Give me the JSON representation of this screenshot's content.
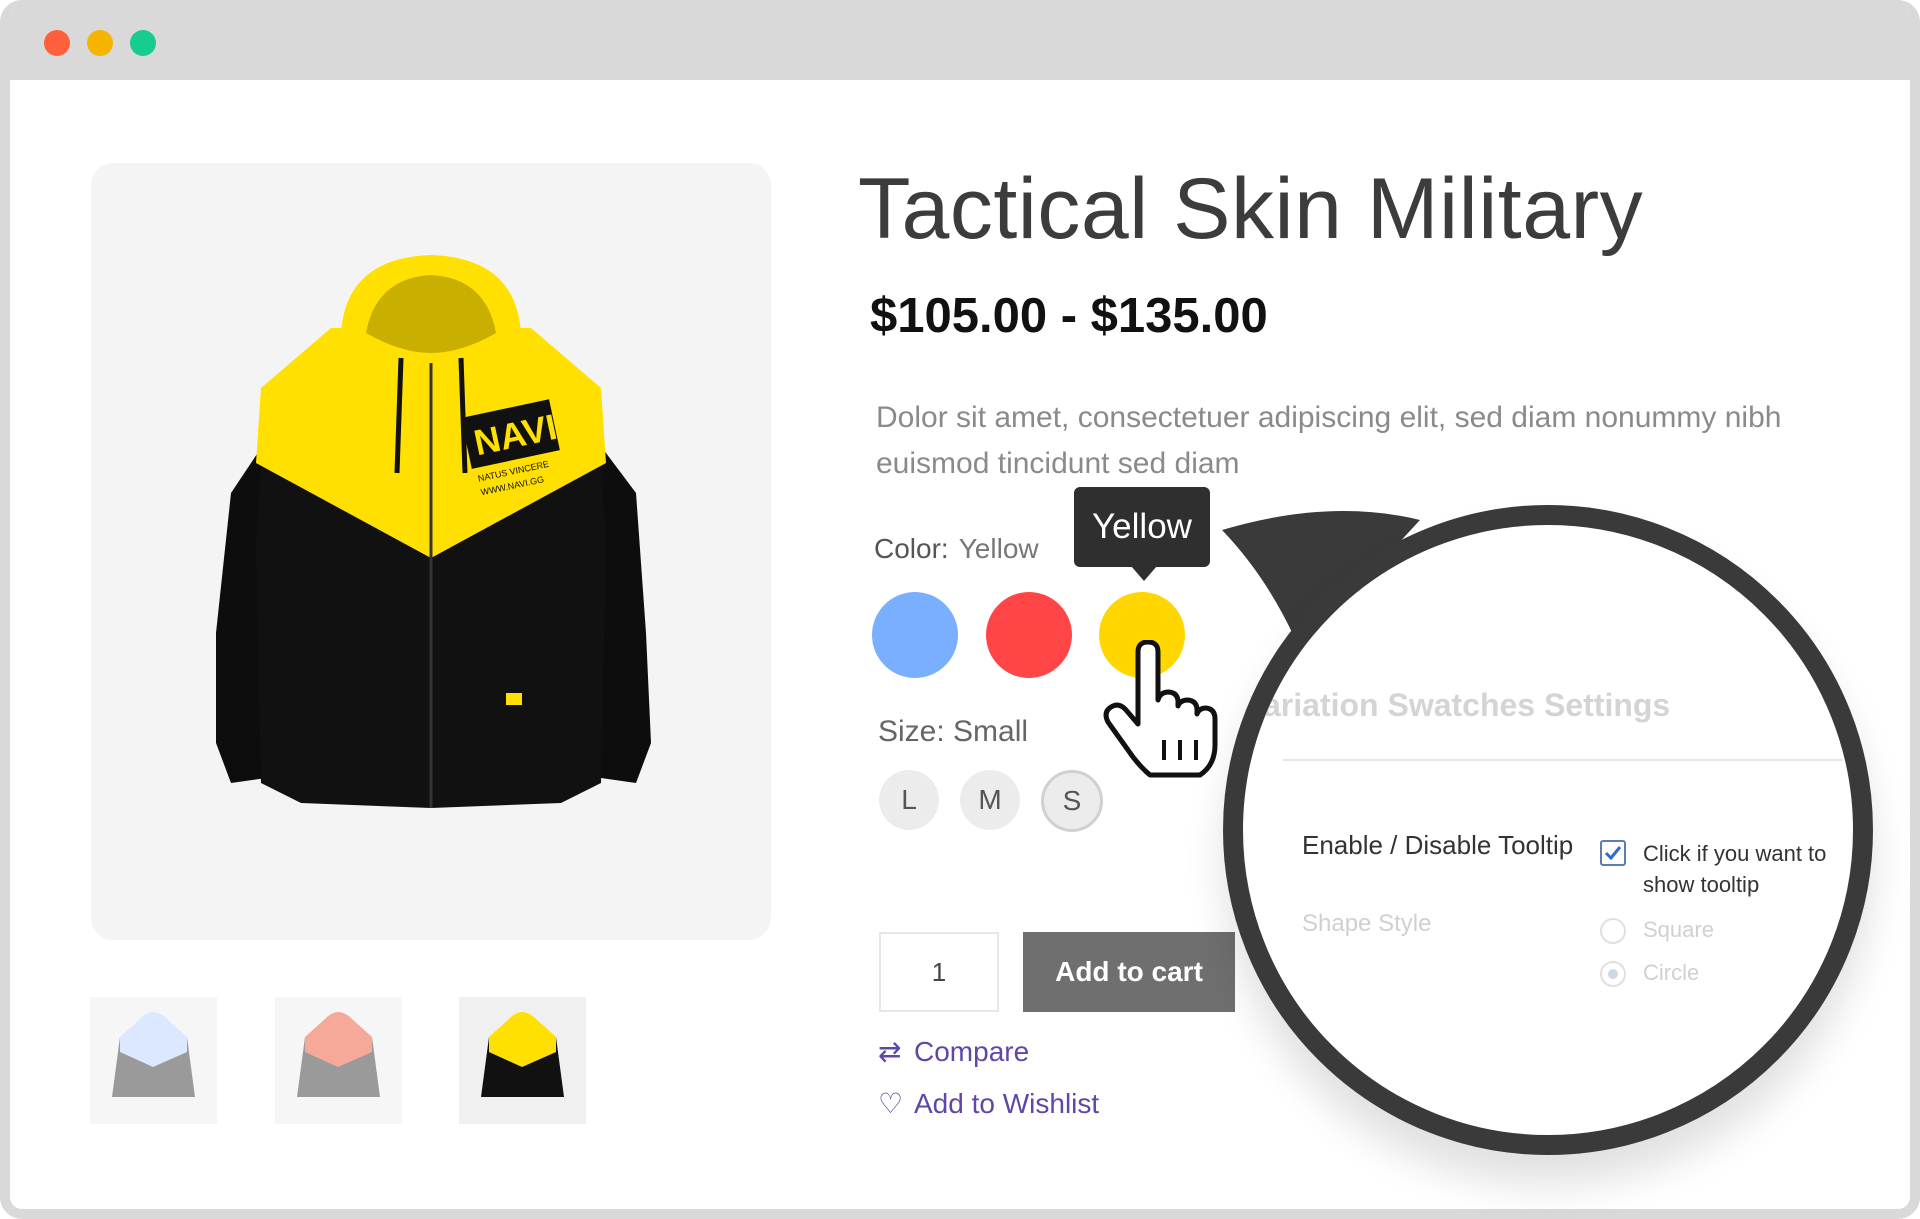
{
  "window": {
    "controls": [
      "close",
      "minimize",
      "maximize"
    ]
  },
  "product": {
    "title": "Tactical Skin Military",
    "price": "$105.00 - $135.00",
    "description": "Dolor sit amet, consectetuer adipiscing elit, sed diam nonummy nibh euismod tincidunt sed diam",
    "color_label": "Color:",
    "color_value": "Yellow",
    "colors": [
      {
        "name": "blue",
        "hex": "#7aaeff"
      },
      {
        "name": "red",
        "hex": "#ff4545"
      },
      {
        "name": "yellow",
        "hex": "#ffd600"
      }
    ],
    "tooltip": "Yellow",
    "size_label": "Size: Small",
    "sizes": [
      "L",
      "M",
      "S"
    ],
    "quantity": "1",
    "add_to_cart": "Add to cart",
    "compare": "Compare",
    "wishlist": "Add to Wishlist",
    "logo_text": "NAVI",
    "logo_sub": "NATUS VINCERE",
    "logo_url": "WWW.NAVI.GG"
  },
  "settings": {
    "title": "ariation Swatches Settings",
    "tooltip_label": "Enable / Disable Tooltip",
    "tooltip_checkbox_text": "Click if you want to show tooltip",
    "tooltip_checked": true,
    "shape_label": "Shape Style",
    "shape_options": [
      "Square",
      "Circle"
    ],
    "shape_selected": "Circle"
  },
  "colors": {
    "accent_link": "#6046a8",
    "magnifier_border": "#3a3a3a",
    "cart_button": "#6f6f6f"
  }
}
